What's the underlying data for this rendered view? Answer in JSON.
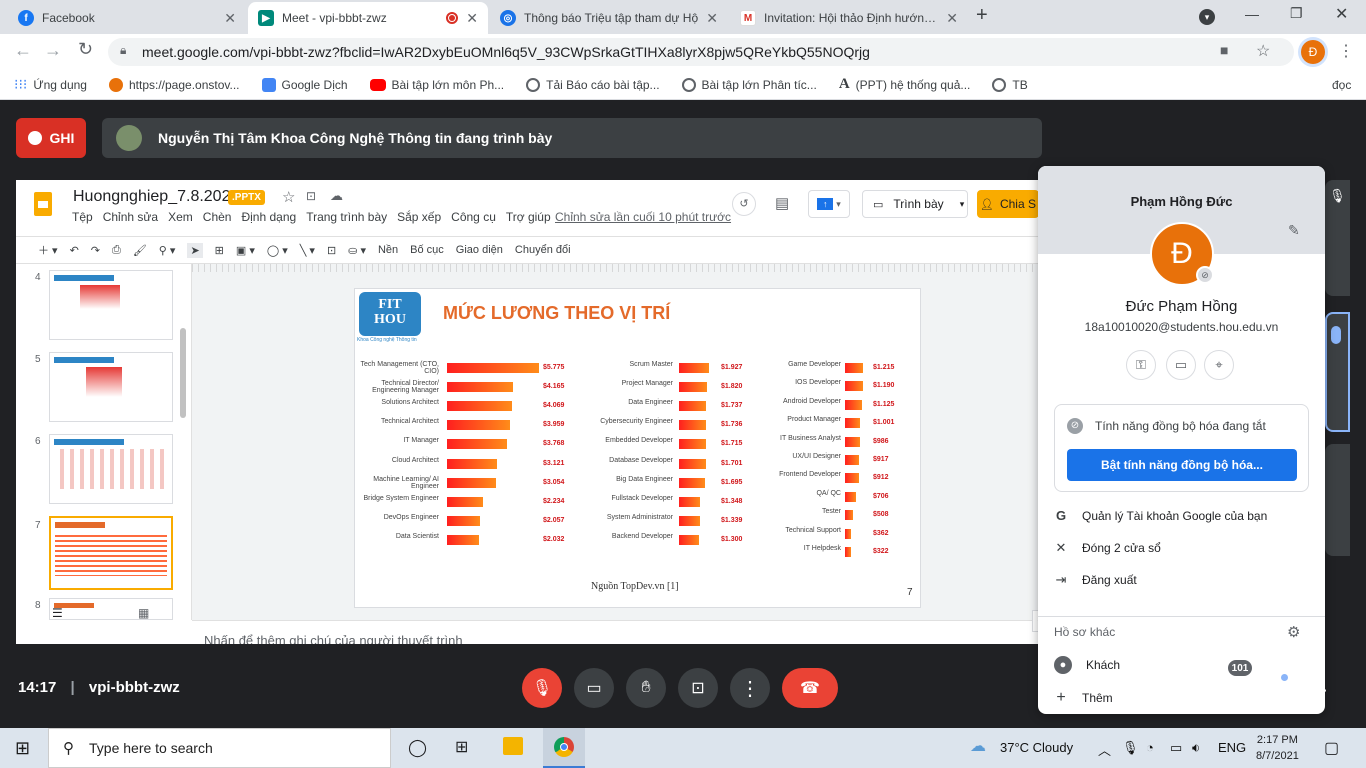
{
  "browser": {
    "tabs": [
      {
        "title": "Facebook",
        "icon": "facebook-icon",
        "color": "#1877f2"
      },
      {
        "title": "Meet - vpi-bbbt-zwz",
        "icon": "meet-icon",
        "color": "#00897b"
      },
      {
        "title": "Thông báo Triệu tập tham dự Hộ",
        "icon": "globe-icon",
        "color": "#1a73e8"
      },
      {
        "title": "Invitation: Hội thảo Định hướng c",
        "icon": "gmail-icon",
        "color": "#d93025"
      }
    ],
    "new_tab": "+",
    "url": "meet.google.com/vpi-bbbt-zwz?fbclid=IwAR2DxybEuOMnl6q5V_93CWpSrkaGtTIHXa8lyrX8pjw5QReYkbQ55NOQrjg",
    "bookmarks": [
      {
        "label": "Ứng dụng",
        "color": "#4285f4"
      },
      {
        "label": "https://page.onstov...",
        "color": "#e8710a"
      },
      {
        "label": "Google Dịch",
        "color": "#4285f4"
      },
      {
        "label": "Bài tập lớn môn Ph...",
        "color": "#ff0000"
      },
      {
        "label": "Tải Báo cáo bài tập...",
        "color": "#5f6368"
      },
      {
        "label": "Bài tập lớn Phân tíc...",
        "color": "#5f6368"
      },
      {
        "label": "(PPT) hệ thống quả...",
        "color": "#202124"
      },
      {
        "label": "TB",
        "color": "#5f6368"
      }
    ],
    "bookmarks_right": "đọc"
  },
  "meet": {
    "record_label": "GHI",
    "presenter_text": "Nguyễn Thị Tâm Khoa Công Nghệ Thông tin đang trình bày",
    "time": "14:17",
    "meeting_code": "vpi-bbbt-zwz",
    "participants_count": "101",
    "accent": "#ea4335"
  },
  "slides": {
    "doc_title": "Huongnghiep_7.8.2021",
    "ext_badge": ".PPTX",
    "menu": [
      "Tệp",
      "Chỉnh sửa",
      "Xem",
      "Chèn",
      "Định dạng",
      "Trang trình bày",
      "Sắp xếp",
      "Công cụ",
      "Trợ giúp"
    ],
    "last_edit": "Chỉnh sửa lần cuối 10 phút trước",
    "present_label": "Trình bày",
    "share_label": "Chia S",
    "toolbar_items": [
      "Nền",
      "Bố cục",
      "Giao diện",
      "Chuyển đổi"
    ],
    "thumb_numbers": [
      "4",
      "5",
      "6",
      "7",
      "8"
    ],
    "notes_placeholder": "Nhấn để thêm ghi chú của người thuyết trình",
    "slide": {
      "logo_line1": "FIT",
      "logo_line2": "HOU",
      "logo_sub": "Khoa Công nghệ Thông tin",
      "title": "MỨC LƯƠNG THEO VỊ TRÍ",
      "source": "Nguồn TopDev.vn [1]",
      "page": "7",
      "columns": [
        {
          "rows": [
            {
              "role": "Tech Management (CTO, CIO)",
              "value": 5775,
              "label": "$5.775"
            },
            {
              "role": "Technical Director/ Engineering Manager",
              "value": 4165,
              "label": "$4.165"
            },
            {
              "role": "Solutions Architect",
              "value": 4069,
              "label": "$4.069"
            },
            {
              "role": "Technical Architect",
              "value": 3959,
              "label": "$3.959"
            },
            {
              "role": "IT Manager",
              "value": 3768,
              "label": "$3.768"
            },
            {
              "role": "Cloud Architect",
              "value": 3121,
              "label": "$3.121"
            },
            {
              "role": "Machine Learning/ AI Engineer",
              "value": 3054,
              "label": "$3.054"
            },
            {
              "role": "Bridge System Engineer",
              "value": 2234,
              "label": "$2.234"
            },
            {
              "role": "DevOps Engineer",
              "value": 2057,
              "label": "$2.057"
            },
            {
              "role": "Data Scientist",
              "value": 2032,
              "label": "$2.032"
            }
          ]
        },
        {
          "rows": [
            {
              "role": "Scrum Master",
              "value": 1927,
              "label": "$1.927"
            },
            {
              "role": "Project Manager",
              "value": 1820,
              "label": "$1.820"
            },
            {
              "role": "Data Engineer",
              "value": 1737,
              "label": "$1.737"
            },
            {
              "role": "Cybersecurity Engineer",
              "value": 1736,
              "label": "$1.736"
            },
            {
              "role": "Embedded Developer",
              "value": 1715,
              "label": "$1.715"
            },
            {
              "role": "Database Developer",
              "value": 1701,
              "label": "$1.701"
            },
            {
              "role": "Big Data Engineer",
              "value": 1695,
              "label": "$1.695"
            },
            {
              "role": "Fullstack Developer",
              "value": 1348,
              "label": "$1.348"
            },
            {
              "role": "System Administrator",
              "value": 1339,
              "label": "$1.339"
            },
            {
              "role": "Backend Developer",
              "value": 1300,
              "label": "$1.300"
            }
          ]
        },
        {
          "rows": [
            {
              "role": "Game Developer",
              "value": 1215,
              "label": "$1.215"
            },
            {
              "role": "IOS Developer",
              "value": 1190,
              "label": "$1.190"
            },
            {
              "role": "Android Developer",
              "value": 1125,
              "label": "$1.125"
            },
            {
              "role": "Product Manager",
              "value": 1001,
              "label": "$1.001"
            },
            {
              "role": "IT Business Analyst",
              "value": 986,
              "label": "$986"
            },
            {
              "role": "UX/UI Designer",
              "value": 917,
              "label": "$917"
            },
            {
              "role": "Frontend Developer",
              "value": 912,
              "label": "$912"
            },
            {
              "role": "QA/ QC",
              "value": 706,
              "label": "$706"
            },
            {
              "role": "Tester",
              "value": 508,
              "label": "$508"
            },
            {
              "role": "Technical Support",
              "value": 362,
              "label": "$362"
            },
            {
              "role": "IT Helpdesk",
              "value": 322,
              "label": "$322"
            }
          ]
        }
      ]
    }
  },
  "profile": {
    "header_name": "Phạm Hồng Đức",
    "avatar_letter": "Đ",
    "display_name": "Đức Phạm Hồng",
    "email": "18a10010020@students.hou.edu.vn",
    "sync_status": "Tính năng đồng bộ hóa đang tắt",
    "sync_button": "Bật tính năng đồng bộ hóa...",
    "menu": [
      {
        "label": "Quản lý Tài khoản Google của bạn",
        "icon": "google-icon"
      },
      {
        "label": "Đóng 2 cửa sổ",
        "icon": "close-icon"
      },
      {
        "label": "Đăng xuất",
        "icon": "sign-out-icon"
      }
    ],
    "other_profiles_label": "Hồ sơ khác",
    "guest_label": "Khách",
    "add_label": "Thêm",
    "avatar_color": "#e8710a"
  },
  "taskbar": {
    "search_placeholder": "Type here to search",
    "weather": "37°C  Cloudy",
    "lang": "ENG",
    "time": "2:17 PM",
    "date": "8/7/2021"
  }
}
